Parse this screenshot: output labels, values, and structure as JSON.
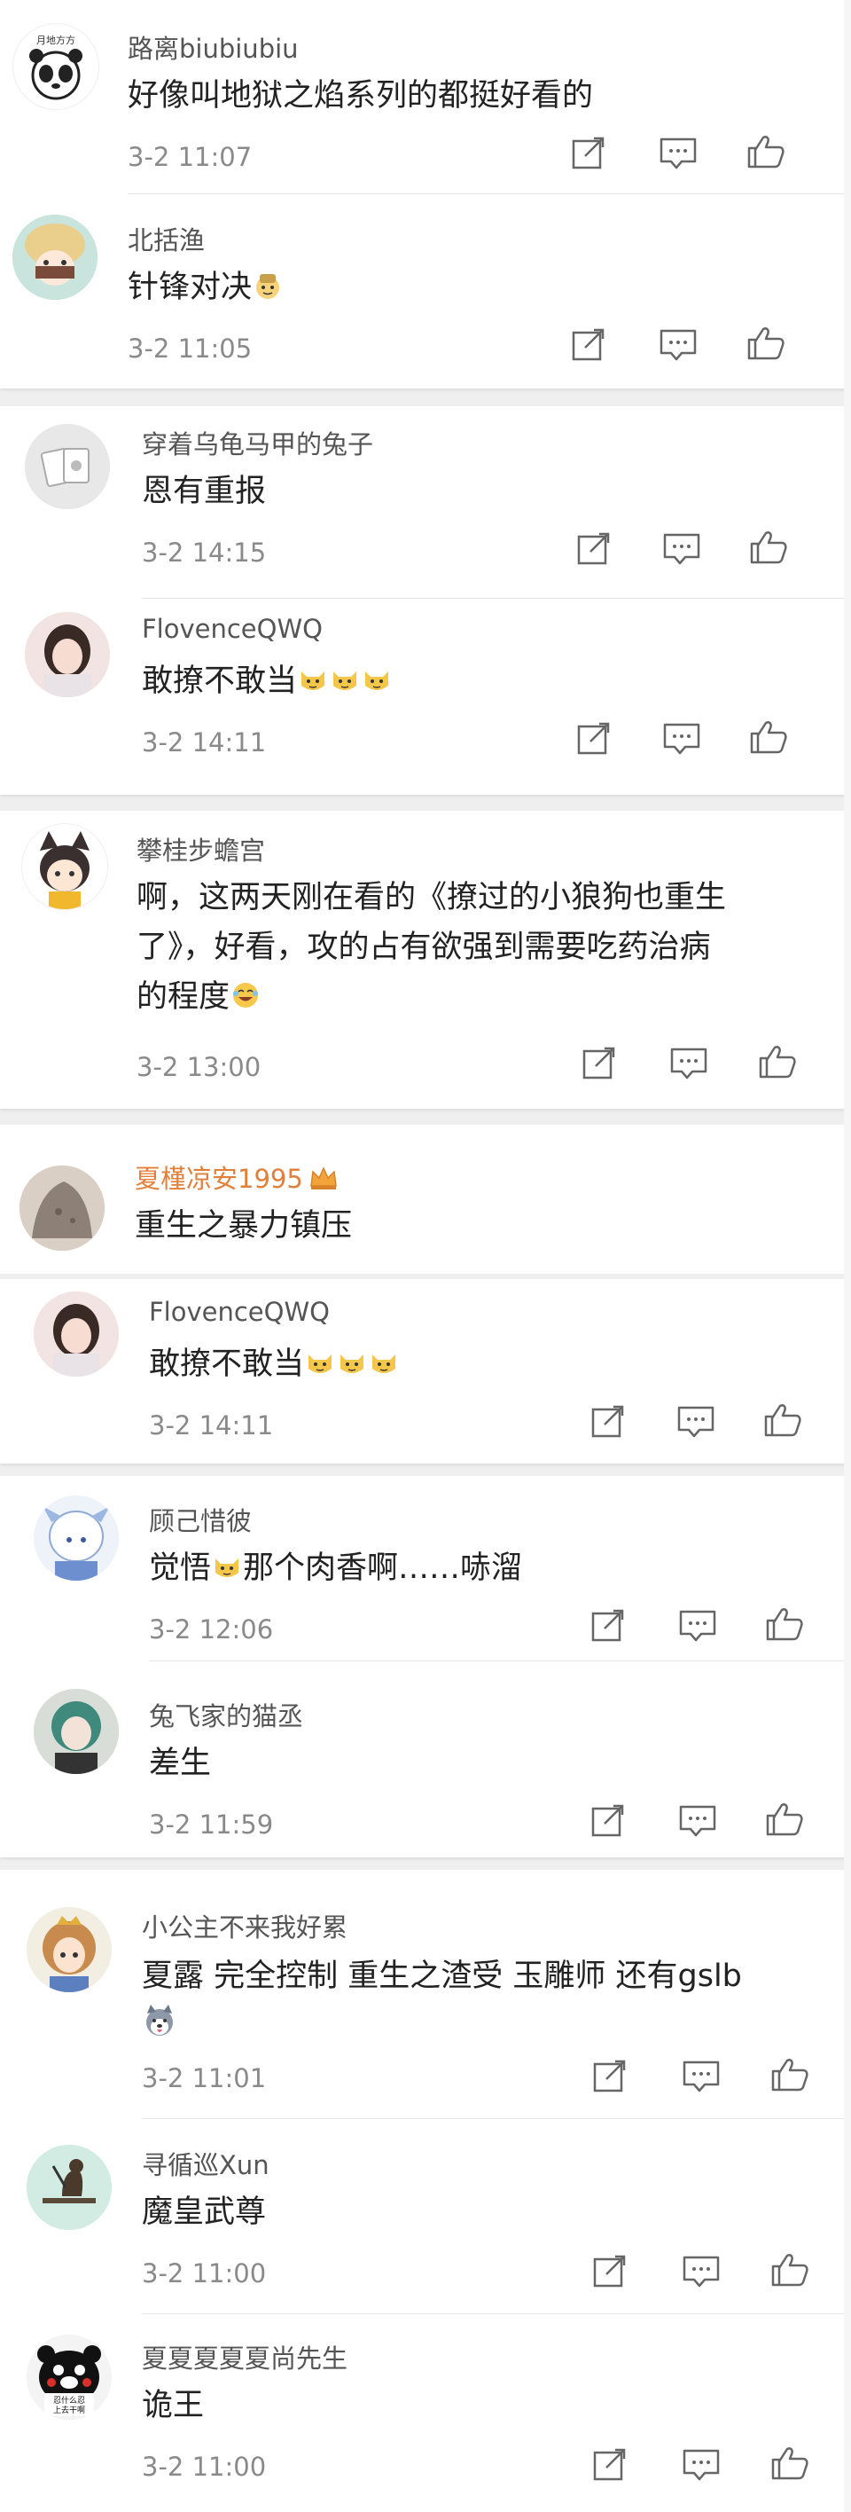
{
  "comments": [
    {
      "name": "路离biubiubiu",
      "text": "好像叫地狱之焰系列的都挺好看的",
      "time": "3-2 11:07"
    },
    {
      "name": "北括渔",
      "text": "针锋对决",
      "time": "3-2 11:05"
    },
    {
      "name": "穿着乌龟马甲的兔子",
      "text": "恩有重报",
      "time": "3-2 14:15"
    },
    {
      "name": "FlovenceQWQ",
      "text": "敢撩不敢当",
      "time": "3-2 14:11"
    },
    {
      "name": "攀桂步蟾宫",
      "text_lines": [
        "啊，这两天刚在看的《撩过的小狼狗也重生",
        "了》，好看，攻的占有欲强到需要吃药治病",
        "的程度"
      ],
      "time": "3-2 13:00"
    },
    {
      "name": "夏槿凉安1995",
      "text": "重生之暴力镇压"
    },
    {
      "name": "FlovenceQWQ",
      "text": "敢撩不敢当",
      "time": "3-2 14:11"
    },
    {
      "name": "顾己惜彼",
      "text_before": "觉悟",
      "text_after": "那个肉香啊……哧溜",
      "time": "3-2 12:06"
    },
    {
      "name": "兔飞家的猫丞",
      "text": "差生",
      "time": "3-2 11:59"
    },
    {
      "name": "小公主不来我好累",
      "text": "夏露 完全控制 重生之渣受 玉雕师 还有gslb",
      "time": "3-2 11:01"
    },
    {
      "name": "寻循巡Xun",
      "text": "魔皇武尊",
      "time": "3-2 11:00"
    },
    {
      "name": "夏夏夏夏夏尚先生",
      "text": "诡王",
      "time": "3-2 11:00"
    }
  ],
  "avatar_texts": {
    "a0": "月地方方",
    "a11_line1": "忍什么忍",
    "a11_line2": "上去干啊"
  },
  "icons": {
    "share": "share-icon",
    "comment": "comment-icon",
    "like": "like-icon"
  },
  "colors": {
    "vip_name": "#e0803a",
    "name": "#555555",
    "time": "#8a8a8a",
    "gap": "#efefef"
  }
}
